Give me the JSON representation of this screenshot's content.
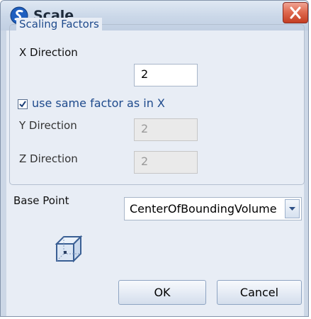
{
  "window": {
    "title": "Scale"
  },
  "scaling_group": {
    "label": "Scaling Factors",
    "x_label": "X Direction",
    "x_value": "2",
    "same_factor_checked": true,
    "same_factor_label": "use same factor as in X",
    "y_label": "Y Direction",
    "y_value": "2",
    "z_label": "Z Direction",
    "z_value": "2"
  },
  "base_point": {
    "label": "Base Point",
    "selected": "CenterOfBoundingVolume"
  },
  "buttons": {
    "ok": "OK",
    "cancel": "Cancel"
  },
  "colors": {
    "accent_text": "#1e4a8c",
    "close_button": "#d9533a",
    "dialog_bg": "#e8edf5"
  },
  "icons": [
    "app-logo-icon",
    "close-icon",
    "checkmark-icon",
    "dropdown-arrow-icon",
    "bounding-box-cube-icon"
  ]
}
